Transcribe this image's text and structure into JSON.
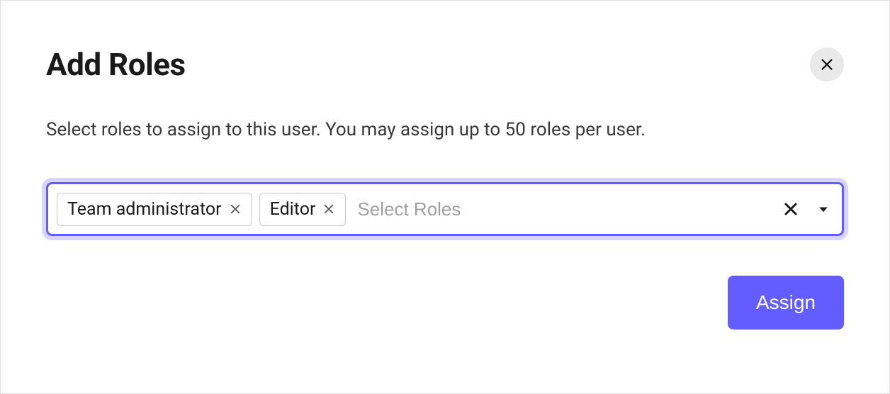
{
  "dialog": {
    "title": "Add Roles",
    "description": "Select roles to assign to this user. You may assign up to 50 roles per user.",
    "placeholder": "Select Roles",
    "assign_label": "Assign"
  },
  "selected_roles": [
    {
      "label": "Team administrator"
    },
    {
      "label": "Editor"
    }
  ],
  "colors": {
    "accent": "#635dff",
    "focus_ring": "#d7d5fc"
  }
}
